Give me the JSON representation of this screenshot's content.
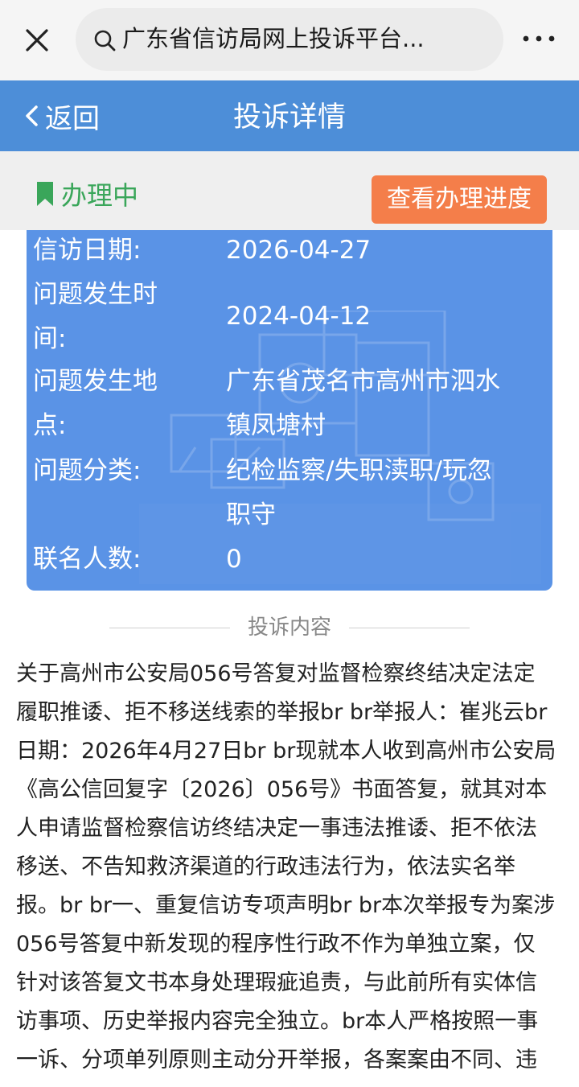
{
  "browser": {
    "search_text": "广东省信访局网上投诉平台...",
    "close_icon": "close-icon",
    "more_icon": "more-icon"
  },
  "header": {
    "back_label": "返回",
    "title": "投诉详情"
  },
  "status": {
    "label": "办理中",
    "progress_button": "查看办理进度",
    "color_status": "#3aa65a",
    "color_button": "#f47e4a"
  },
  "info": {
    "rows": [
      {
        "label": "信访日期:",
        "value": "2026-04-27"
      },
      {
        "label_line1": "问题发生时",
        "label_line2": "间:",
        "value": "2024-04-12"
      },
      {
        "label_line1": "问题发生地",
        "label_line2": "点:",
        "value_line1": "广东省茂名市高州市泗水",
        "value_line2": "镇凤塘村"
      },
      {
        "label": "问题分类:",
        "value_line1": "纪检监察/失职渎职/玩忽",
        "value_line2": "职守"
      },
      {
        "label": "联名人数:",
        "value": "0"
      }
    ],
    "card_color": "#5a93e6"
  },
  "section": {
    "title": "投诉内容"
  },
  "content": {
    "lines": [
      "关于高州市公安局056号答复对监督检察终结决定法定",
      "履职推诿、拒不移送线索的举报br br举报人：崔兆云br",
      "日期：2026年4月27日br br现就本人收到高州市公安局",
      "《高公信回复字〔2026〕056号》书面答复，就其对本",
      "人申请监督检察信访终结决定一事违法推诿、拒不依法",
      "移送、不告知救济渠道的行政违法行为，依法实名举",
      "报。br br一、重复信访专项声明br br本次举报专为案涉",
      "056号答复中新发现的程序性行政不作为单独立案，仅",
      "针对该答复文书本身处理瑕疵追责，与此前所有实体信",
      "访事项、历史举报内容完全独立。br本人严格按照一事",
      "一诉、分项单列原则主动分开举报，各案案由不同、违"
    ]
  },
  "header_color": "#4d8ed8"
}
